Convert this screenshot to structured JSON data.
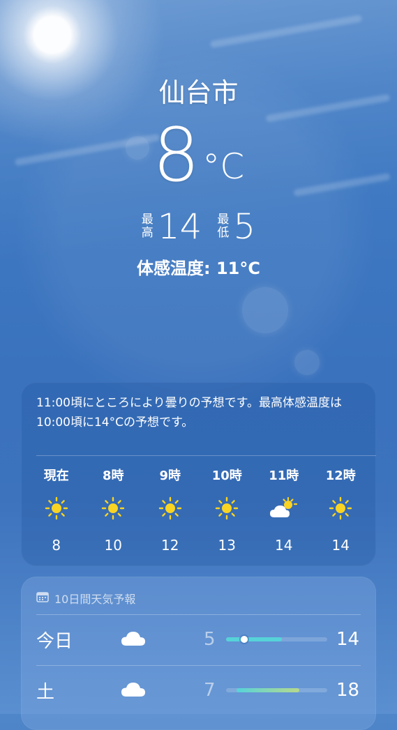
{
  "location": {
    "city": "仙台市"
  },
  "current": {
    "temp": "8",
    "unit": "°C",
    "high_label": "最高",
    "high": "14",
    "low_label": "最低",
    "low": "5",
    "feels_like": "体感温度: 11°C"
  },
  "hourly": {
    "summary": "11:00頃にところにより曇りの予想です。最高体感温度は10:00頃に14°Cの予想です。",
    "items": [
      {
        "time": "現在",
        "icon": "sun-icon",
        "temp": "8"
      },
      {
        "time": "8時",
        "icon": "sun-icon",
        "temp": "10"
      },
      {
        "time": "9時",
        "icon": "sun-icon",
        "temp": "12"
      },
      {
        "time": "10時",
        "icon": "sun-icon",
        "temp": "13"
      },
      {
        "time": "11時",
        "icon": "partly-cloudy-icon",
        "temp": "14"
      },
      {
        "time": "12時",
        "icon": "sun-icon",
        "temp": "14"
      }
    ]
  },
  "daily": {
    "title": "10日間天気予報",
    "title_icon": "calendar-icon",
    "items": [
      {
        "day": "今日",
        "icon": "cloud-icon",
        "low": "5",
        "high": "14",
        "range_start": 0.0,
        "range_end": 0.55,
        "current_pos": 0.18
      },
      {
        "day": "土",
        "icon": "cloud-icon",
        "low": "7",
        "high": "18",
        "range_start": 0.1,
        "range_end": 0.72
      }
    ]
  },
  "colors": {
    "sun": "#f9d423",
    "bar_today": "#56d3d9",
    "bar_tomorrow_start": "#56d3d9",
    "bar_tomorrow_end": "#b7d98b"
  }
}
